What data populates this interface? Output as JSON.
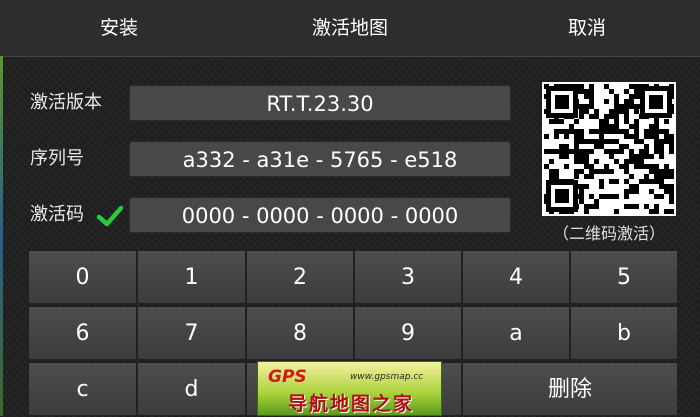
{
  "header": {
    "install_label": "安装",
    "title": "激活地图",
    "cancel_label": "取消"
  },
  "form": {
    "version_label": "激活版本",
    "version_value": "RT.T.23.30",
    "serial_label": "序列号",
    "serial_value": "a332 - a31e - 5765 - e518",
    "code_label": "激活码",
    "code_value": "0000 - 0000 - 0000 - 0000"
  },
  "qr": {
    "caption": "（二维码激活）"
  },
  "keypad": {
    "row1": [
      "0",
      "1",
      "2",
      "3",
      "4",
      "5"
    ],
    "row2": [
      "6",
      "7",
      "8",
      "9",
      "a",
      "b"
    ],
    "row3": [
      "c",
      "d"
    ],
    "delete_label": "删除"
  },
  "banner": {
    "logo": "GPS",
    "url": "www.gpsmap.cc",
    "name": "导航地图之家"
  },
  "colors": {
    "check": "#27c93f",
    "field_bg": "#484848",
    "key_bg": "#454545"
  }
}
